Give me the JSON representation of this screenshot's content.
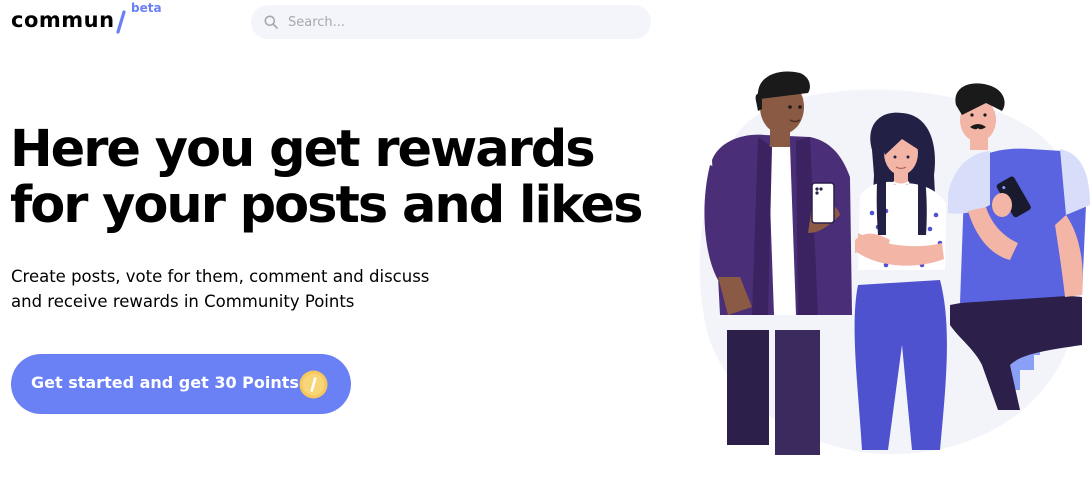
{
  "header": {
    "logo_text": "commun",
    "logo_badge": "beta",
    "search": {
      "placeholder": "Search..."
    }
  },
  "hero": {
    "headline": "Here you get rewards for your posts and likes",
    "subtext_line1": "Create posts, vote for them, comment and discuss",
    "subtext_line2": "and receive rewards in Community Points",
    "cta_label": "Get started and get 30 Points"
  },
  "colors": {
    "accent": "#6a80f5",
    "coin": "#f6c85a",
    "search_bg": "#f3f5fa",
    "text": "#000000"
  },
  "icons": [
    "search-icon",
    "coin-icon",
    "logo-slash-icon"
  ]
}
